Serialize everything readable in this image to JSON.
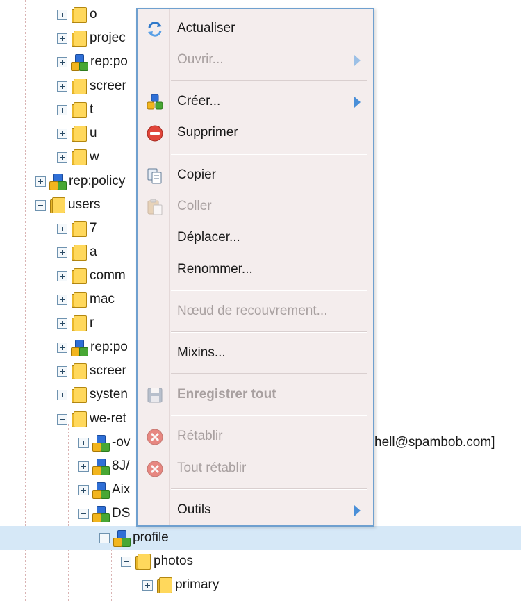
{
  "tree": {
    "rows": [
      {
        "label": "o",
        "icon": "folder-icon",
        "expander": "plus"
      },
      {
        "label": "projec",
        "icon": "folder-icon",
        "expander": "plus"
      },
      {
        "label": "rep:po",
        "icon": "node-cubes-icon",
        "expander": "plus"
      },
      {
        "label": "screer",
        "icon": "folder-icon",
        "expander": "plus"
      },
      {
        "label": "t",
        "icon": "folder-icon",
        "expander": "plus"
      },
      {
        "label": "u",
        "icon": "folder-icon",
        "expander": "plus"
      },
      {
        "label": "w",
        "icon": "folder-icon",
        "expander": "plus"
      },
      {
        "label": "rep:policy",
        "icon": "node-cubes-icon",
        "expander": "plus"
      },
      {
        "label": "users",
        "icon": "folder-icon",
        "expander": "minus"
      },
      {
        "label": "7",
        "icon": "folder-icon",
        "expander": "plus"
      },
      {
        "label": "a",
        "icon": "folder-icon",
        "expander": "plus"
      },
      {
        "label": "comm",
        "icon": "folder-icon",
        "expander": "plus"
      },
      {
        "label": "mac",
        "icon": "folder-icon",
        "expander": "plus"
      },
      {
        "label": "r",
        "icon": "folder-icon",
        "expander": "plus"
      },
      {
        "label": "rep:po",
        "icon": "node-cubes-icon",
        "expander": "plus"
      },
      {
        "label": "screer",
        "icon": "folder-icon",
        "expander": "plus"
      },
      {
        "label": "systen",
        "icon": "folder-icon",
        "expander": "plus"
      },
      {
        "label": "we-ret",
        "icon": "folder-icon",
        "expander": "minus"
      },
      {
        "label": "-ov",
        "icon": "node-cubes-icon",
        "expander": "plus",
        "suffix": "hell@spambob.com]"
      },
      {
        "label": "8J/",
        "icon": "node-cubes-icon",
        "expander": "plus"
      },
      {
        "label": "Aix",
        "icon": "node-cubes-icon",
        "expander": "plus"
      },
      {
        "label": "DS",
        "icon": "node-cubes-icon",
        "expander": "minus"
      },
      {
        "label": "profile",
        "icon": "node-cubes-icon",
        "expander": "minus",
        "selected": true
      },
      {
        "label": "photos",
        "icon": "folder-icon",
        "expander": "minus"
      },
      {
        "label": "primary",
        "icon": "folder-icon",
        "expander": "plus"
      }
    ]
  },
  "context_menu": {
    "items": [
      {
        "label": "Actualiser",
        "icon": "refresh-icon",
        "enabled": true
      },
      {
        "label": "Ouvrir...",
        "icon": "",
        "enabled": false,
        "submenu": true
      },
      {
        "label": "Créer...",
        "icon": "create-node-icon",
        "enabled": true,
        "submenu": true
      },
      {
        "label": "Supprimer",
        "icon": "delete-icon",
        "enabled": true
      },
      {
        "label": "Copier",
        "icon": "copy-icon",
        "enabled": true
      },
      {
        "label": "Coller",
        "icon": "paste-icon",
        "enabled": false
      },
      {
        "label": "Déplacer...",
        "icon": "",
        "enabled": true
      },
      {
        "label": "Renommer...",
        "icon": "",
        "enabled": true
      },
      {
        "label": "Nœud de recouvrement...",
        "icon": "",
        "enabled": false
      },
      {
        "label": "Mixins...",
        "icon": "",
        "enabled": true
      },
      {
        "label": "Enregistrer tout",
        "icon": "save-icon",
        "enabled": false,
        "bold": true
      },
      {
        "label": "Rétablir",
        "icon": "revert-icon",
        "enabled": false
      },
      {
        "label": "Tout rétablir",
        "icon": "revert-all-icon",
        "enabled": false
      },
      {
        "label": "Outils",
        "icon": "",
        "enabled": true,
        "submenu": true
      }
    ]
  },
  "colors": {
    "selection": "#d6e8f7",
    "menu_background": "#f4eded",
    "menu_border": "#6fa0cf",
    "submenu_arrow": "#4a8fd8"
  }
}
